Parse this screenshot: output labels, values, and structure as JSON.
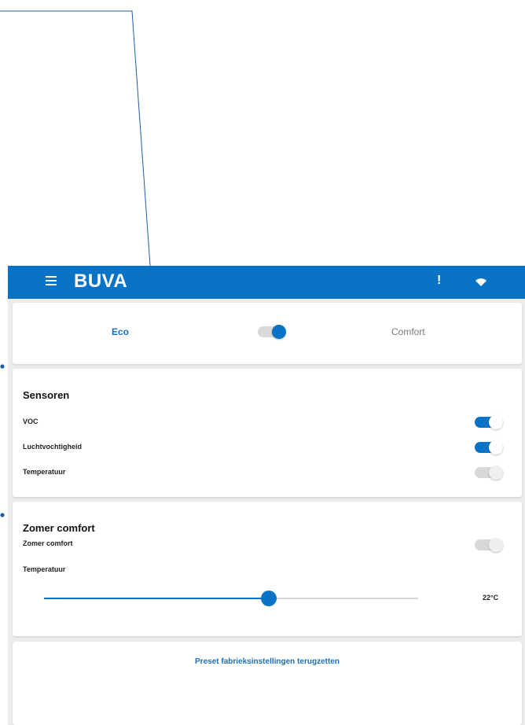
{
  "header": {
    "brand": "BUVA",
    "alert_glyph": "!",
    "menu_icon": "hamburger-menu-icon",
    "wifi_icon": "wifi-icon"
  },
  "mode": {
    "left_label": "Eco",
    "right_label": "Comfort",
    "toggle_state": "right"
  },
  "sensors": {
    "title": "Sensoren",
    "items": [
      {
        "label": "VOC",
        "enabled": true
      },
      {
        "label": "Luchtvochtigheid",
        "enabled": true
      },
      {
        "label": "Temperatuur",
        "enabled": false
      }
    ]
  },
  "zomer": {
    "title": "Zomer comfort",
    "toggle_label": "Zomer comfort",
    "toggle_enabled": false,
    "temperature_label": "Temperatuur",
    "slider_fraction": 0.6,
    "temperature_value": "22°C"
  },
  "reset": {
    "label": "Preset fabrieksinstellingen terugzetten"
  },
  "colors": {
    "brand": "#0b73c6",
    "link": "#1b6fb8",
    "background": "#ececec",
    "annotation": "#1f5aa8"
  }
}
